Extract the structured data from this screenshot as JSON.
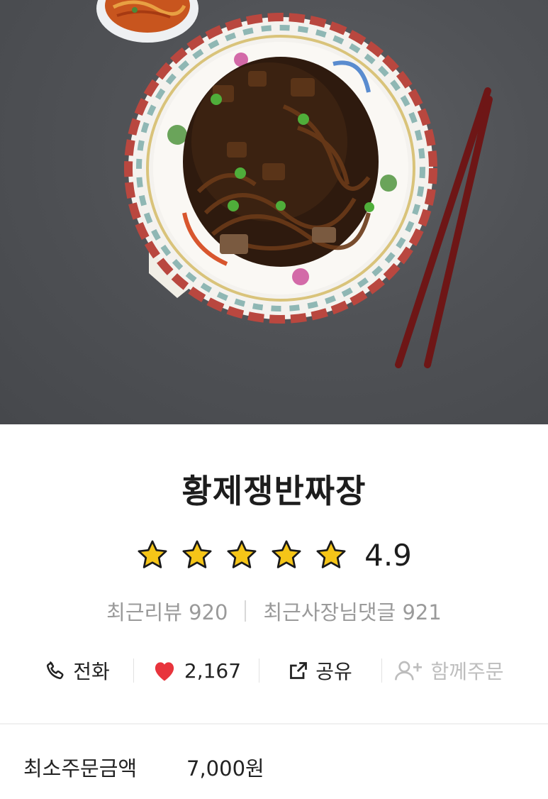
{
  "store": {
    "name": "황제쟁반짜장",
    "rating": "4.9",
    "star_count": 5,
    "recent_reviews_label": "최근리뷰 920",
    "recent_owner_replies_label": "최근사장님댓글 921"
  },
  "actions": {
    "call_label": "전화",
    "likes_count": "2,167",
    "share_label": "공유",
    "group_order_label": "함께주문"
  },
  "order_info": {
    "min_order_label": "최소주문금액",
    "min_order_value": "7,000원"
  },
  "colors": {
    "star": "#F5C518",
    "heart": "#E8343C",
    "disabled": "#BDBDBD"
  }
}
